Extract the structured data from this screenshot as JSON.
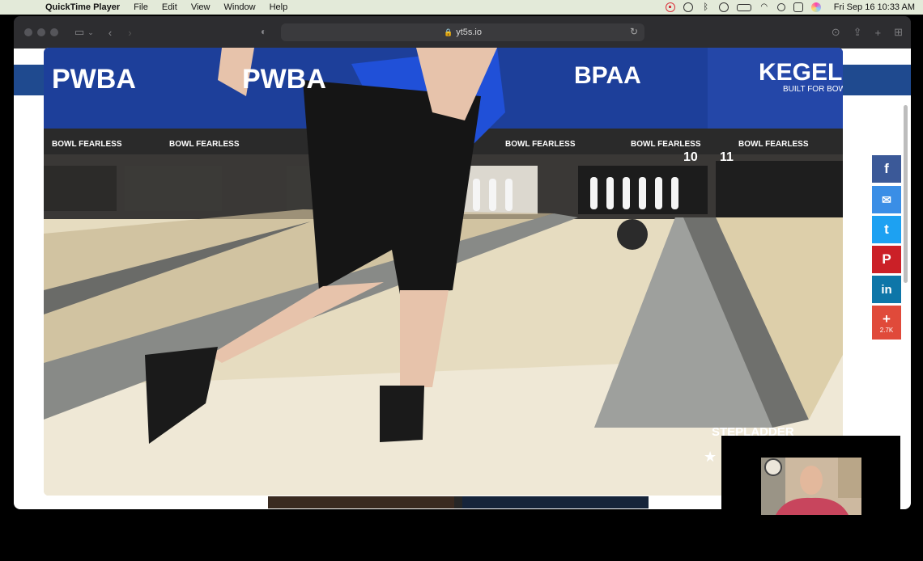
{
  "menubar": {
    "app_name": "QuickTime Player",
    "menus": [
      "File",
      "Edit",
      "View",
      "Window",
      "Help"
    ],
    "status_icons": [
      "record-icon",
      "screen-share-icon",
      "bluetooth-icon",
      "media-icon",
      "battery-icon",
      "wifi-icon",
      "spotlight-icon",
      "control-center-icon",
      "siri-icon"
    ],
    "clock": "Fri Sep 16  10:33 AM"
  },
  "browser": {
    "url": "yt5s.io",
    "share_buttons": [
      {
        "name": "facebook",
        "glyph": "f",
        "color": "#3b5998"
      },
      {
        "name": "messenger",
        "glyph": "✉",
        "color": "#3a8ee6"
      },
      {
        "name": "twitter",
        "glyph": "t",
        "color": "#1da1f2"
      },
      {
        "name": "pinterest",
        "glyph": "P",
        "color": "#cb2027"
      },
      {
        "name": "linkedin",
        "glyph": "in",
        "color": "#0e76a8"
      },
      {
        "name": "more",
        "glyph": "+",
        "color": "#e04a3a",
        "count": "2.7K"
      }
    ]
  },
  "video": {
    "banner_texts": [
      "PWBA",
      "PWBA",
      "BPAA",
      "KEGEL"
    ],
    "banner_sub": "BUILT FOR BOWL",
    "bowl_fearless": "BOWL FEARLESS",
    "lane_numbers": [
      "10",
      "11"
    ],
    "overlay_text": "STEPLADDER",
    "colors": {
      "banner": "#1d3f9a",
      "floor": "#e9dfc2",
      "shirt": "#2050d8"
    }
  }
}
